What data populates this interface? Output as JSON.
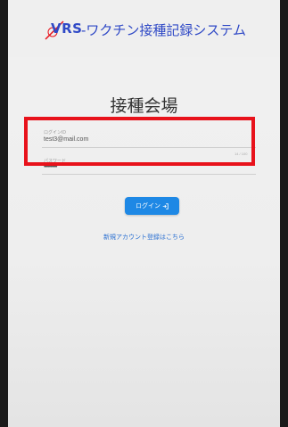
{
  "header": {
    "logo_text": "VRS",
    "app_title": "-ワクチン接種記録システム"
  },
  "page": {
    "venue_title": "接種会場"
  },
  "form": {
    "login_id_label": "ログインID",
    "login_id_value": "test3@mail.com",
    "password_label": "パスワード",
    "password_value": "••••••••••",
    "input_hint": "14 / 100",
    "login_button_label": "ログイン",
    "login_icon": "login-arrow-icon",
    "register_link": "新規アカウント登録はこちら"
  },
  "annotation": {
    "highlight_color": "#e8121b"
  },
  "colors": {
    "brand": "#2f49c6",
    "button": "#1e88e5",
    "link": "#2a6fd1"
  }
}
